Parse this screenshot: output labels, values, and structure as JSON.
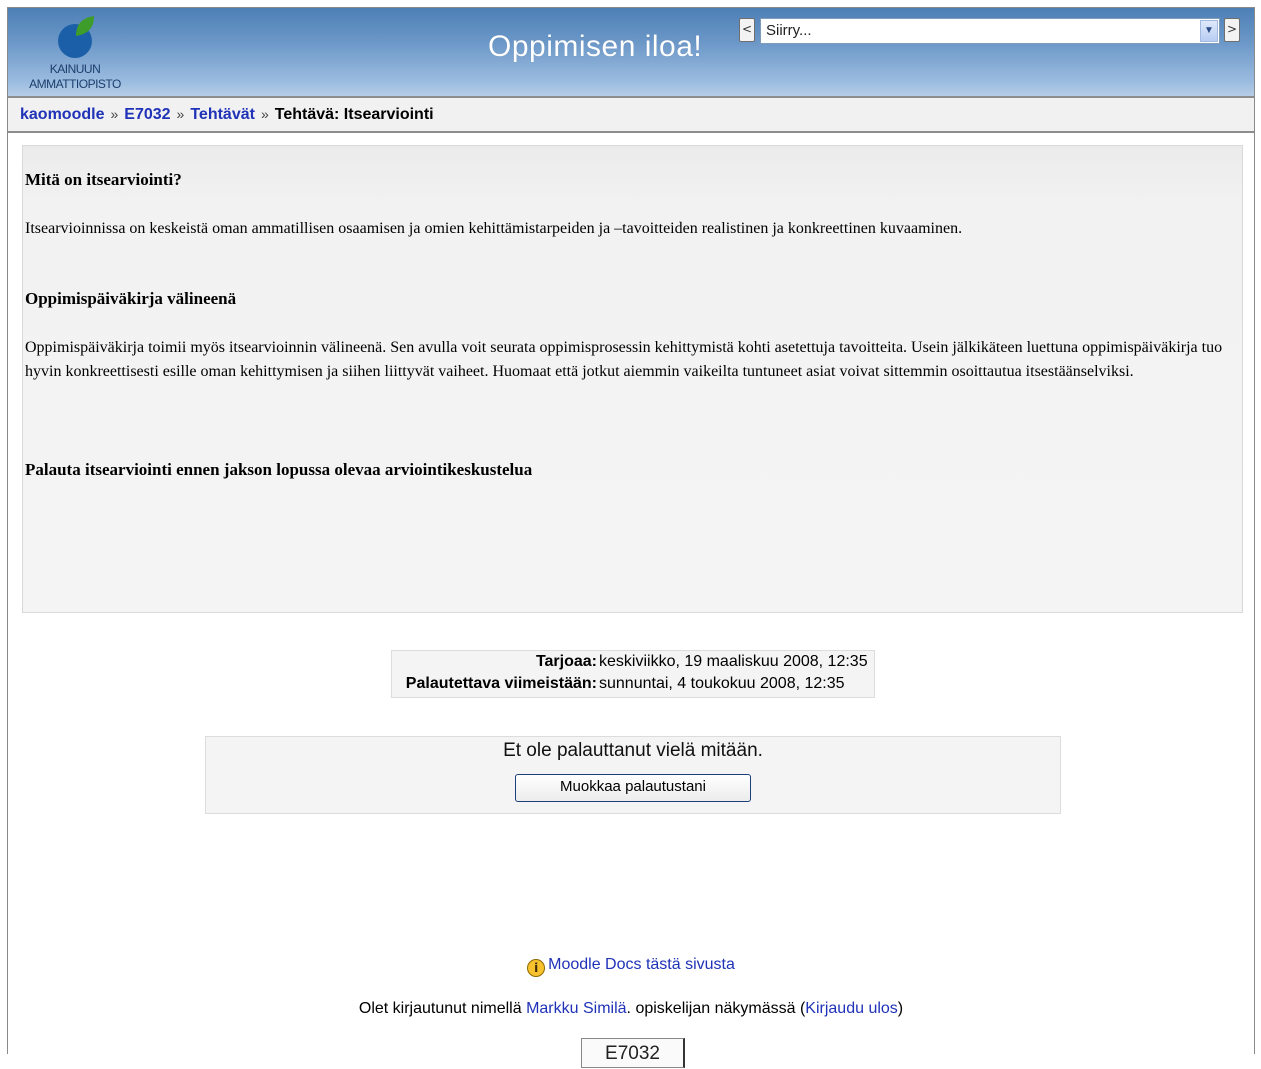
{
  "header": {
    "logo_line1": "KAINUUN",
    "logo_line2": "AMMATTIOPISTO",
    "site_title": "Oppimisen iloa!",
    "prev_label": "<",
    "next_label": ">",
    "jump_placeholder": "Siirry..."
  },
  "breadcrumb": {
    "items": [
      "kaomoodle",
      "E7032",
      "Tehtävät"
    ],
    "separator": "»",
    "current": "Tehtävä: Itsearviointi"
  },
  "intro": {
    "heading1": "Mitä on itsearviointi?",
    "para1": "Itsearvioinnissa on keskeistä oman ammatillisen osaamisen ja omien kehittämistarpeiden ja –tavoitteiden realistinen ja konkreettinen kuvaaminen.",
    "heading2": "Oppimispäiväkirja välineenä",
    "para2": "Oppimispäiväkirja toimii myös itsearvioinnin välineenä. Sen avulla voit seurata oppimisprosessin kehittymistä kohti asetettuja tavoitteita. Usein jälkikäteen luettuna oppimispäiväkirja tuo hyvin konkreettisesti esille oman kehittymisen ja siihen liittyvät vaiheet. Huomaat että jotkut aiemmin vaikeilta tuntuneet asiat voivat sittemmin osoittautua itsestäänselviksi.",
    "heading3": "Palauta itsearviointi ennen jakson lopussa olevaa arviointikeskustelua"
  },
  "dates": {
    "available_label": "Tarjoaa:",
    "available_value": "keskiviikko, 19 maaliskuu 2008, 12:35",
    "due_label": "Palautettava viimeistään:",
    "due_value": "sunnuntai, 4 toukokuu 2008, 12:35"
  },
  "submission": {
    "message": "Et ole palauttanut vielä mitään.",
    "edit_button": "Muokkaa palautustani"
  },
  "footer": {
    "docs_link": "Moodle Docs tästä sivusta",
    "login_prefix": "Olet kirjautunut nimellä",
    "user_name": "Markku Similä",
    "login_middle": ". opiskelijan näkymässä (",
    "logout_link": "Kirjaudu ulos",
    "login_suffix": ")",
    "course_button": "E7032"
  }
}
